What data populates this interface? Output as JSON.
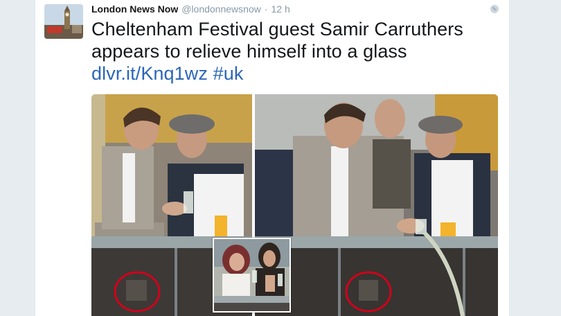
{
  "tweet": {
    "author": {
      "display_name": "London News Now",
      "handle": "@londonnewsnow",
      "avatar_icon": "big-ben-avatar"
    },
    "separator": "·",
    "timestamp": "12 h",
    "text_plain": "Cheltenham Festival guest Samir Carruthers appears to relieve himself into a glass",
    "text_link": "dlvr.it/Knq1wz",
    "text_hashtag": "#uk",
    "visibility_icon": "globe-icon"
  },
  "colors": {
    "link": "#2b66b8",
    "text": "#14171a",
    "muted": "#8899a6",
    "highlight_circle": "#d0021b"
  }
}
